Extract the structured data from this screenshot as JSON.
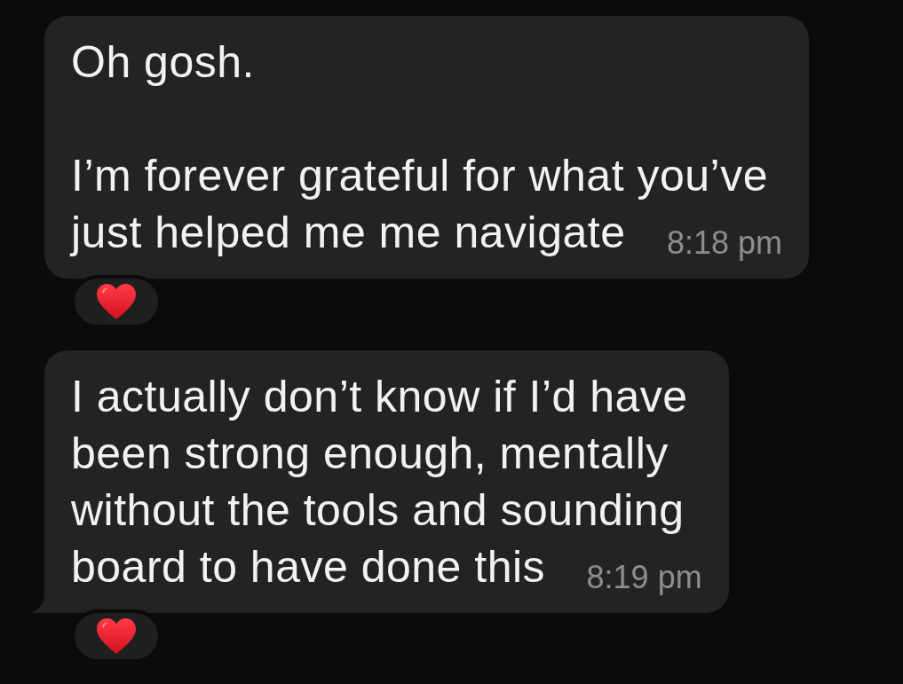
{
  "messages": [
    {
      "paragraphs": [
        [
          "Oh gosh."
        ],
        [
          "I’m forever grateful for what you’ve",
          "just helped me me navigate"
        ]
      ],
      "time": "8:18 pm",
      "tail": false,
      "reaction": {
        "kind": "heart"
      }
    },
    {
      "paragraphs": [
        [
          "I actually don’t know if I’d have",
          "been strong enough, mentally",
          "without the tools and sounding",
          "board to have done this"
        ]
      ],
      "time": "8:19 pm",
      "tail": true,
      "reaction": {
        "kind": "heart"
      }
    }
  ]
}
